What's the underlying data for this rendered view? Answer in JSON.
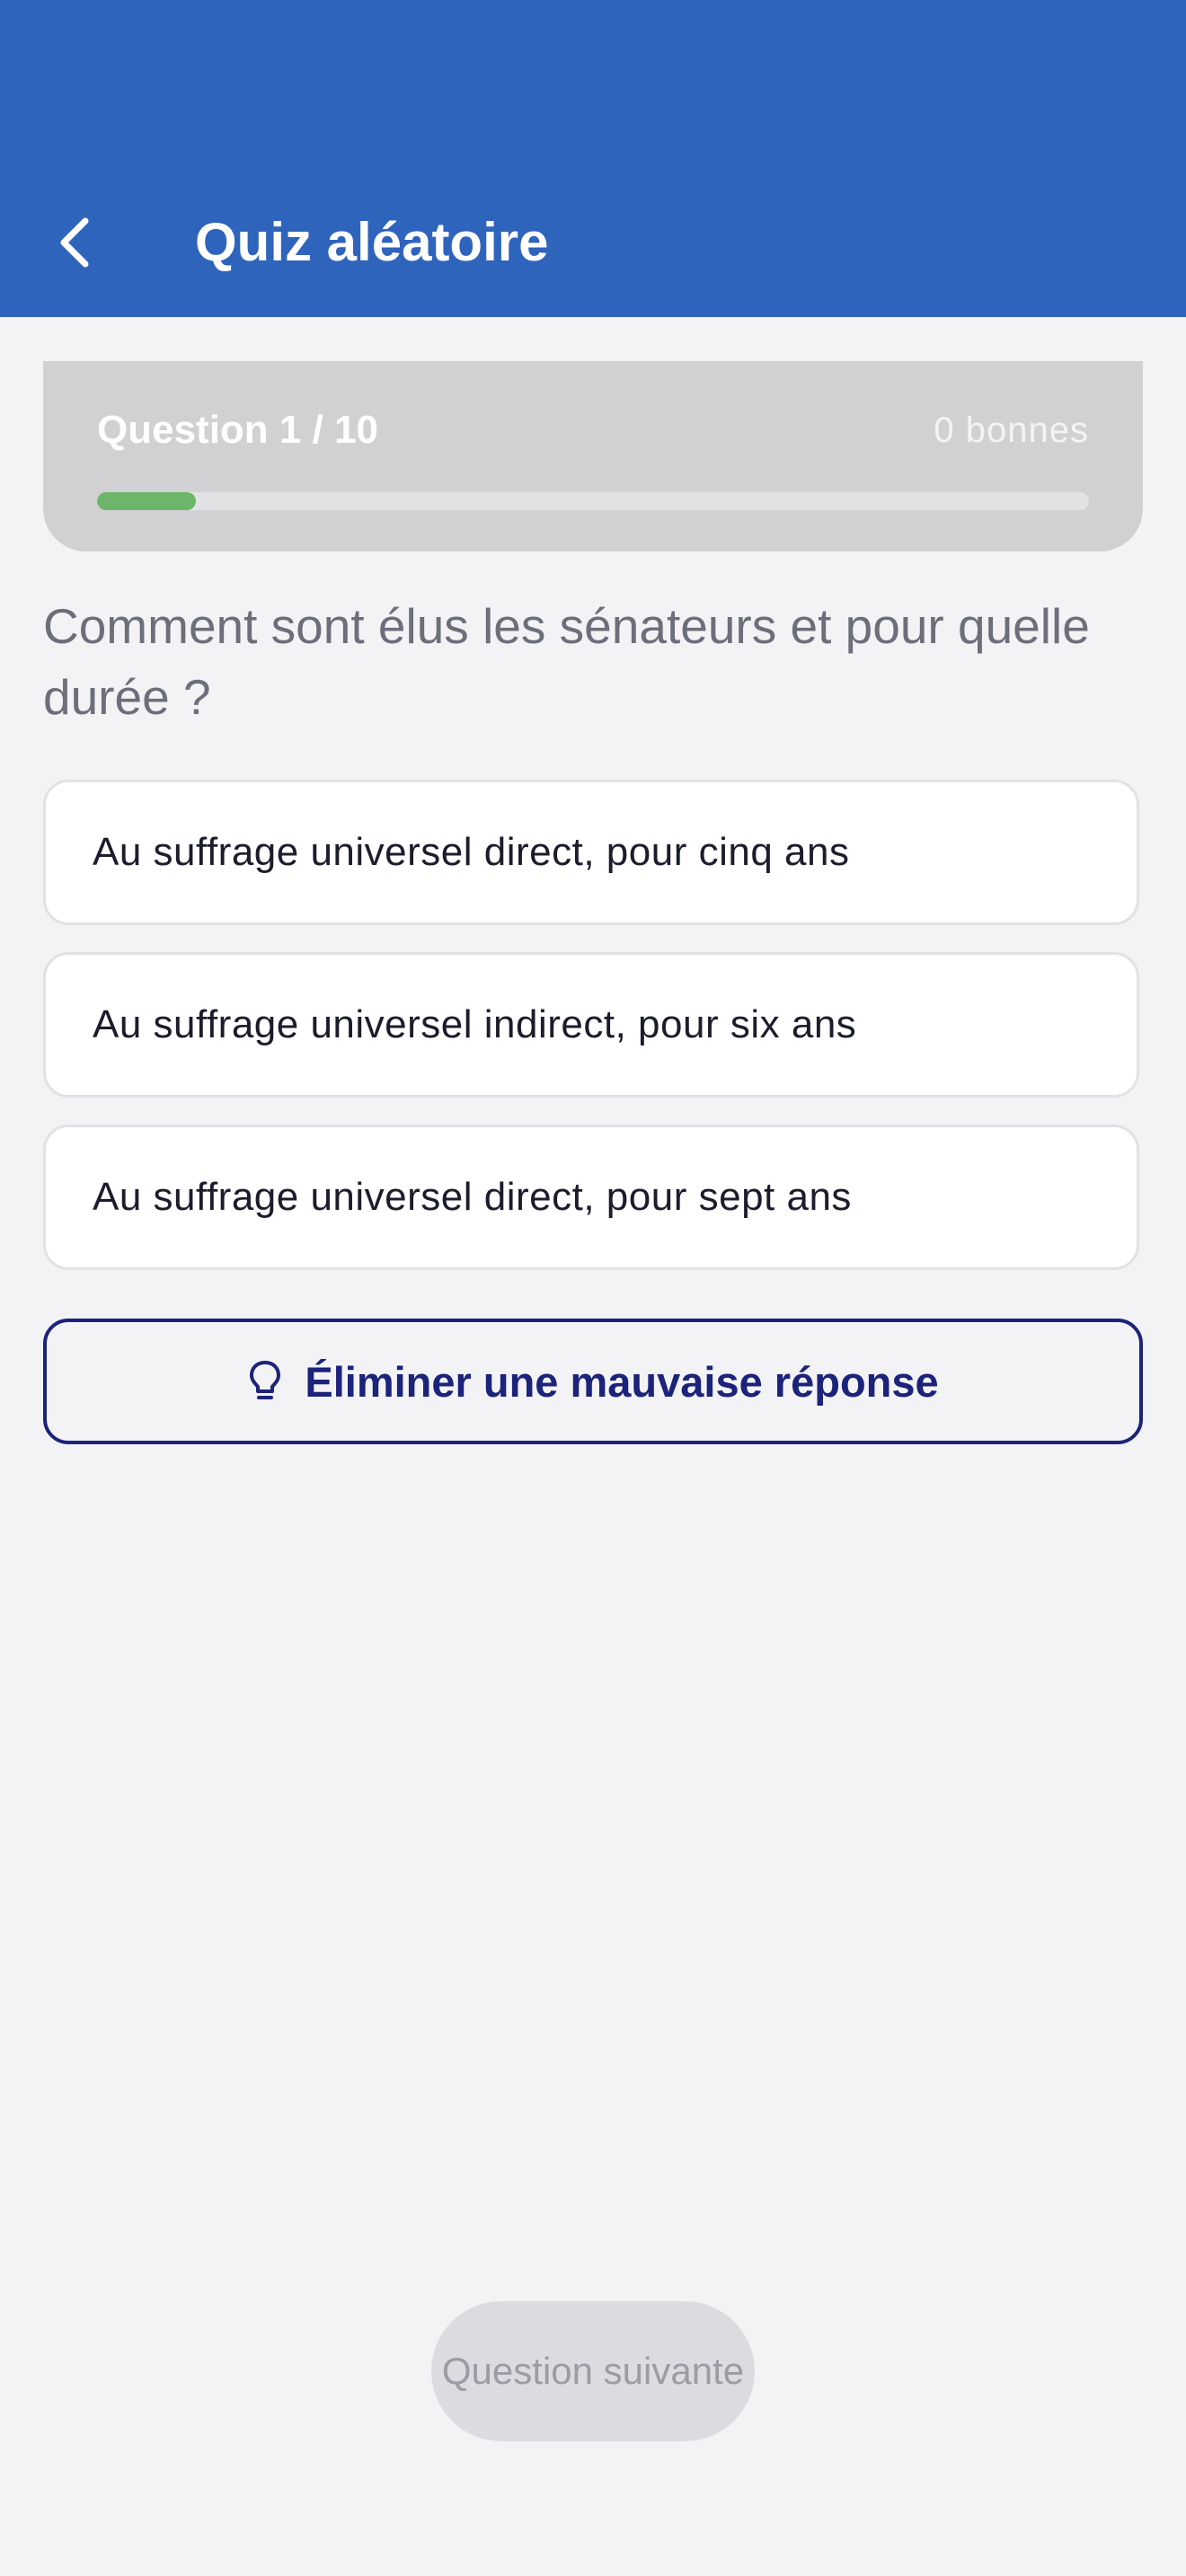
{
  "header": {
    "title": "Quiz aléatoire",
    "back_icon": "chevron-left-icon",
    "background_color": "#2f64bd"
  },
  "progress": {
    "label": "Question 1 / 10",
    "score_label": "0 bonnes",
    "current": 1,
    "total": 10,
    "fill_fraction": 0.1,
    "fill_color": "#6db568"
  },
  "question": {
    "text": "Comment sont élus les sénateurs et pour quelle durée ?"
  },
  "answers": [
    {
      "label": "Au suffrage universel direct, pour cinq ans"
    },
    {
      "label": "Au suffrage universel indirect, pour six ans"
    },
    {
      "label": "Au suffrage universel direct, pour sept ans"
    }
  ],
  "hint_button": {
    "label": "Éliminer une mauvaise réponse",
    "icon": "lightbulb-icon",
    "color": "#1c237a"
  },
  "next_button": {
    "label": "Question suivante",
    "state": "disabled"
  }
}
